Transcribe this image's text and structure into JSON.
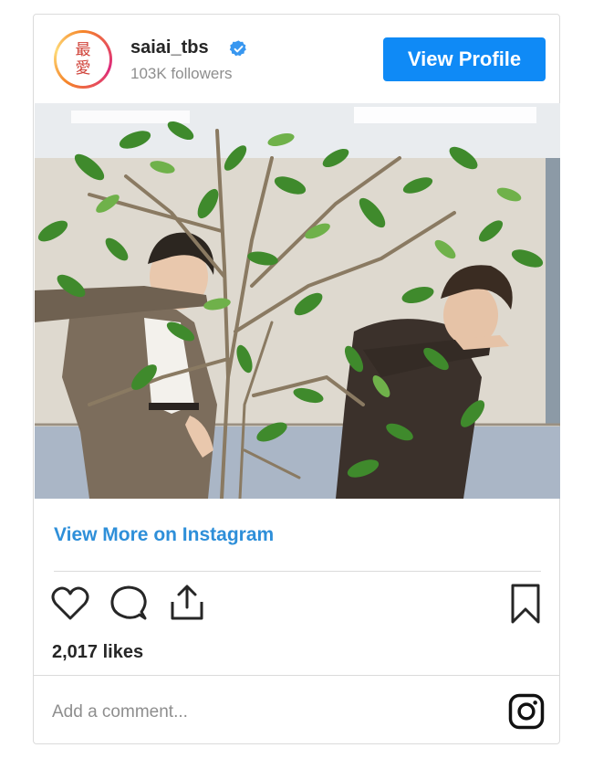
{
  "profile": {
    "avatar_text_top": "最",
    "avatar_text_bottom": "愛",
    "username": "saiai_tbs",
    "followers": "103K followers",
    "view_profile_label": "View Profile"
  },
  "post": {
    "view_more_label": "View More on Instagram",
    "likes": "2,017 likes",
    "comment_placeholder": "Add a comment..."
  },
  "colors": {
    "accent_blue": "#0f8af6",
    "link_blue": "#2e8fd9",
    "text_dark": "#262626",
    "text_muted": "#8e8e8e",
    "border": "#dbdbdb"
  },
  "icons": [
    "verified-badge-icon",
    "heart-icon",
    "comment-icon",
    "share-icon",
    "bookmark-icon",
    "instagram-icon"
  ]
}
